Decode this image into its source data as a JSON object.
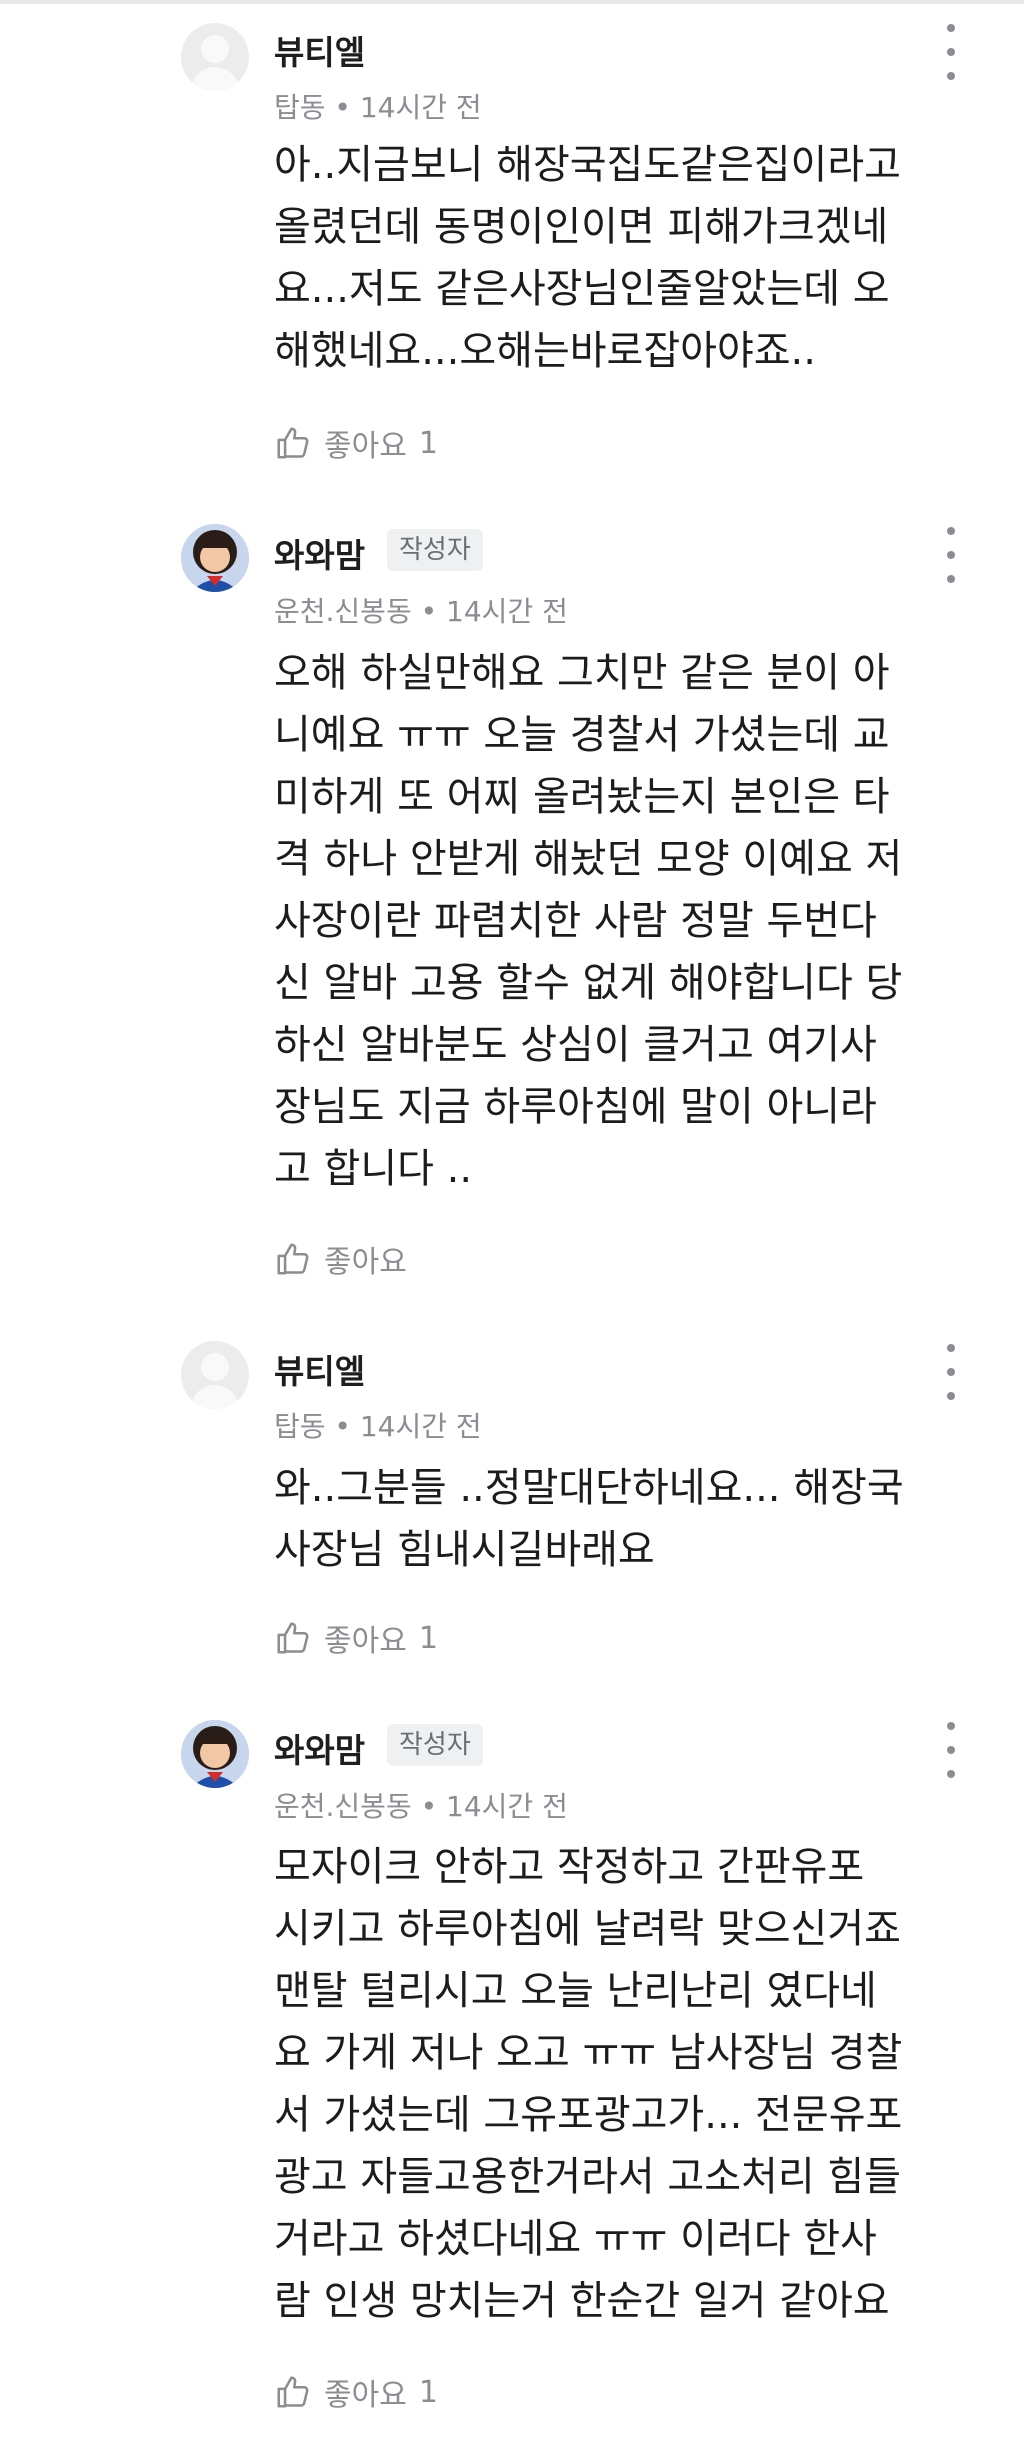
{
  "comments": [
    {
      "author": "뷰티엘",
      "badge": "",
      "meta": "탑동 • 14시간 전",
      "avatar": "default-avatar",
      "lines": [
        "아..지금보니 해장국집도같은집이라고",
        "올렸던데 동명이인이면 피해가크겠네",
        "요...저도 같은사장님인줄알았는데 오",
        "해했네요...오해는바로잡아야죠.."
      ],
      "like_label": "좋아요",
      "like_count": "1"
    },
    {
      "author": "와와맘",
      "badge": "작성자",
      "meta": "운천.신봉동 • 14시간 전",
      "avatar": "profile-photo",
      "lines": [
        "오해 하실만해요 그치만 같은 분이 아",
        "니예요 ㅠㅠ 오늘 경찰서 가셨는데 교",
        "미하게 또 어찌 올려놨는지 본인은 타",
        "격 하나 안받게 해놨던 모양 이예요 저",
        "사장이란 파렴치한 사람 정말 두번다",
        "신 알바 고용 할수 없게 해야합니다 당",
        "하신 알바분도 상심이 클거고 여기사",
        "장님도 지금 하루아침에 말이 아니라",
        "고 합니다 .."
      ],
      "like_label": "좋아요",
      "like_count": ""
    },
    {
      "author": "뷰티엘",
      "badge": "",
      "meta": "탑동 • 14시간 전",
      "avatar": "default-avatar",
      "lines": [
        "와..그분들 ..정말대단하네요... 해장국",
        "사장님 힘내시길바래요"
      ],
      "like_label": "좋아요",
      "like_count": "1"
    },
    {
      "author": "와와맘",
      "badge": "작성자",
      "meta": "운천.신봉동 • 14시간 전",
      "avatar": "profile-photo",
      "lines": [
        "모자이크 안하고 작정하고 간판유포",
        "시키고 하루아침에 날려락 맞으신거죠",
        "맨탈 털리시고 오늘 난리난리 였다네",
        "요 가게 저나 오고 ㅠㅠ 남사장님 경찰",
        "서 가셨는데 그유포광고가... 전문유포",
        "광고 자들고용한거라서 고소처리 힘들",
        "거라고 하셨다네요 ㅠㅠ 이러다 한사",
        "람 인생 망치는거 한순간 일거 같아요"
      ],
      "like_label": "좋아요",
      "like_count": "1"
    }
  ],
  "icons": {
    "like": "thumbs-up-icon",
    "more": "more-vertical-icon"
  },
  "colors": {
    "meta_text": "#8a8d91",
    "badge_bg": "#eef0f2",
    "body_text": "#1c1c1c"
  }
}
